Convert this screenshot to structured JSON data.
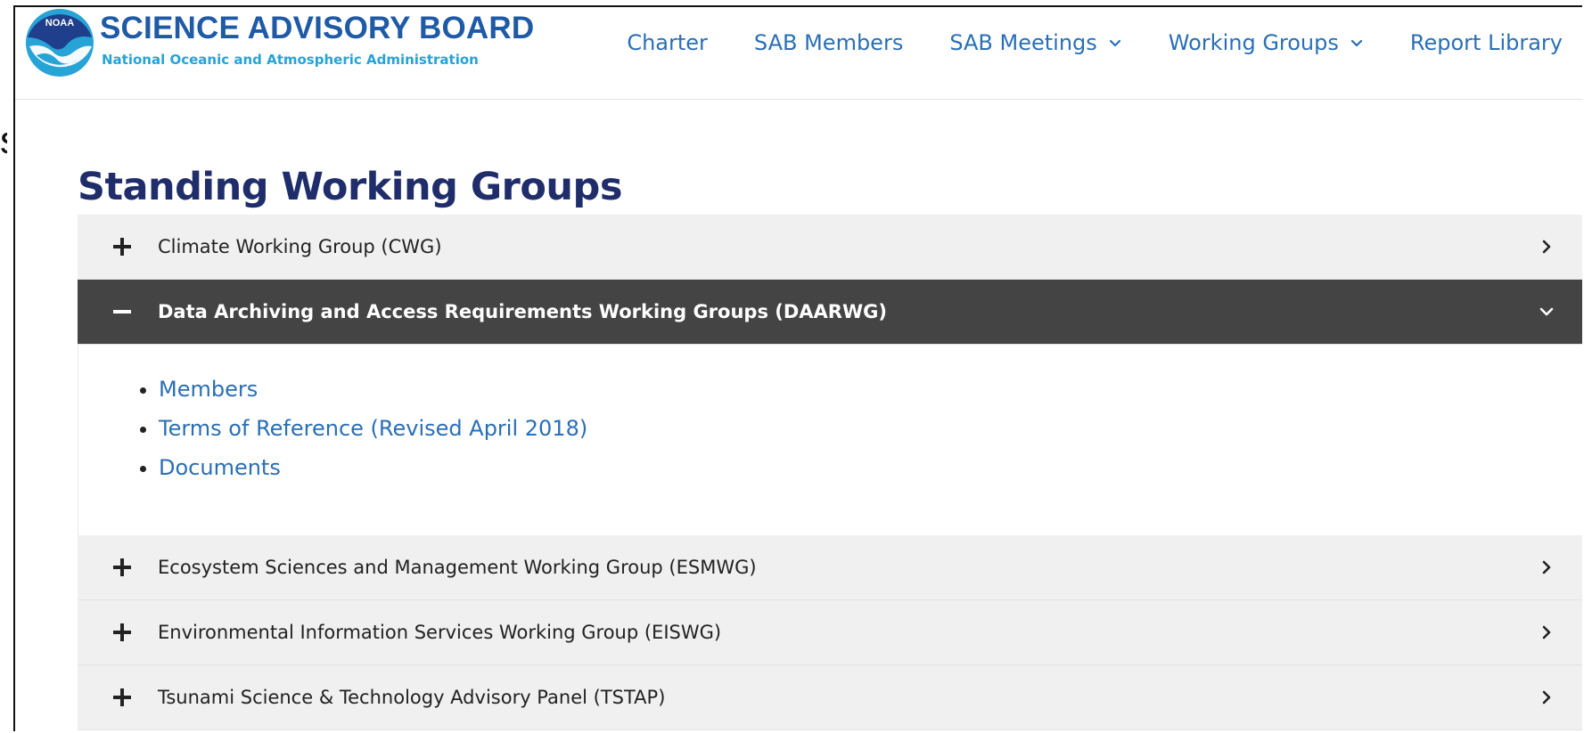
{
  "site": {
    "title": "SCIENCE ADVISORY BOARD",
    "subtitle": "National Oceanic and Atmospheric Administration",
    "emblem_text": "NOAA"
  },
  "nav": {
    "items": [
      {
        "label": "Charter",
        "has_dropdown": false
      },
      {
        "label": "SAB Members",
        "has_dropdown": false
      },
      {
        "label": "SAB Meetings",
        "has_dropdown": true
      },
      {
        "label": "Working Groups",
        "has_dropdown": true
      },
      {
        "label": "Report Library",
        "has_dropdown": false
      }
    ]
  },
  "page": {
    "title": "Standing Working Groups"
  },
  "accordion": {
    "items": [
      {
        "label": "Climate Working Group (CWG)",
        "expanded": false
      },
      {
        "label": "Data Archiving and Access Requirements Working Groups (DAARWG)",
        "expanded": true,
        "links": [
          "Members",
          "Terms of Reference (Revised April 2018)",
          "Documents"
        ]
      },
      {
        "label": "Ecosystem Sciences and Management Working Group (ESMWG)",
        "expanded": false
      },
      {
        "label": "Environmental Information Services Working Group (EISWG)",
        "expanded": false
      },
      {
        "label": "Tsunami Science & Technology Advisory Panel (TSTAP)",
        "expanded": false
      }
    ]
  },
  "colors": {
    "link": "#2a6fb5",
    "title": "#1f2d6b",
    "active_header": "#444444",
    "header_bg": "#f0f0f0",
    "logo_blue": "#1f5aa6",
    "logo_cyan": "#27a3d6"
  },
  "icons": {
    "expand": "plus-icon",
    "collapse": "minus-icon",
    "closed": "chevron-right-icon",
    "open": "chevron-down-icon",
    "dropdown": "chevron-down-icon"
  }
}
